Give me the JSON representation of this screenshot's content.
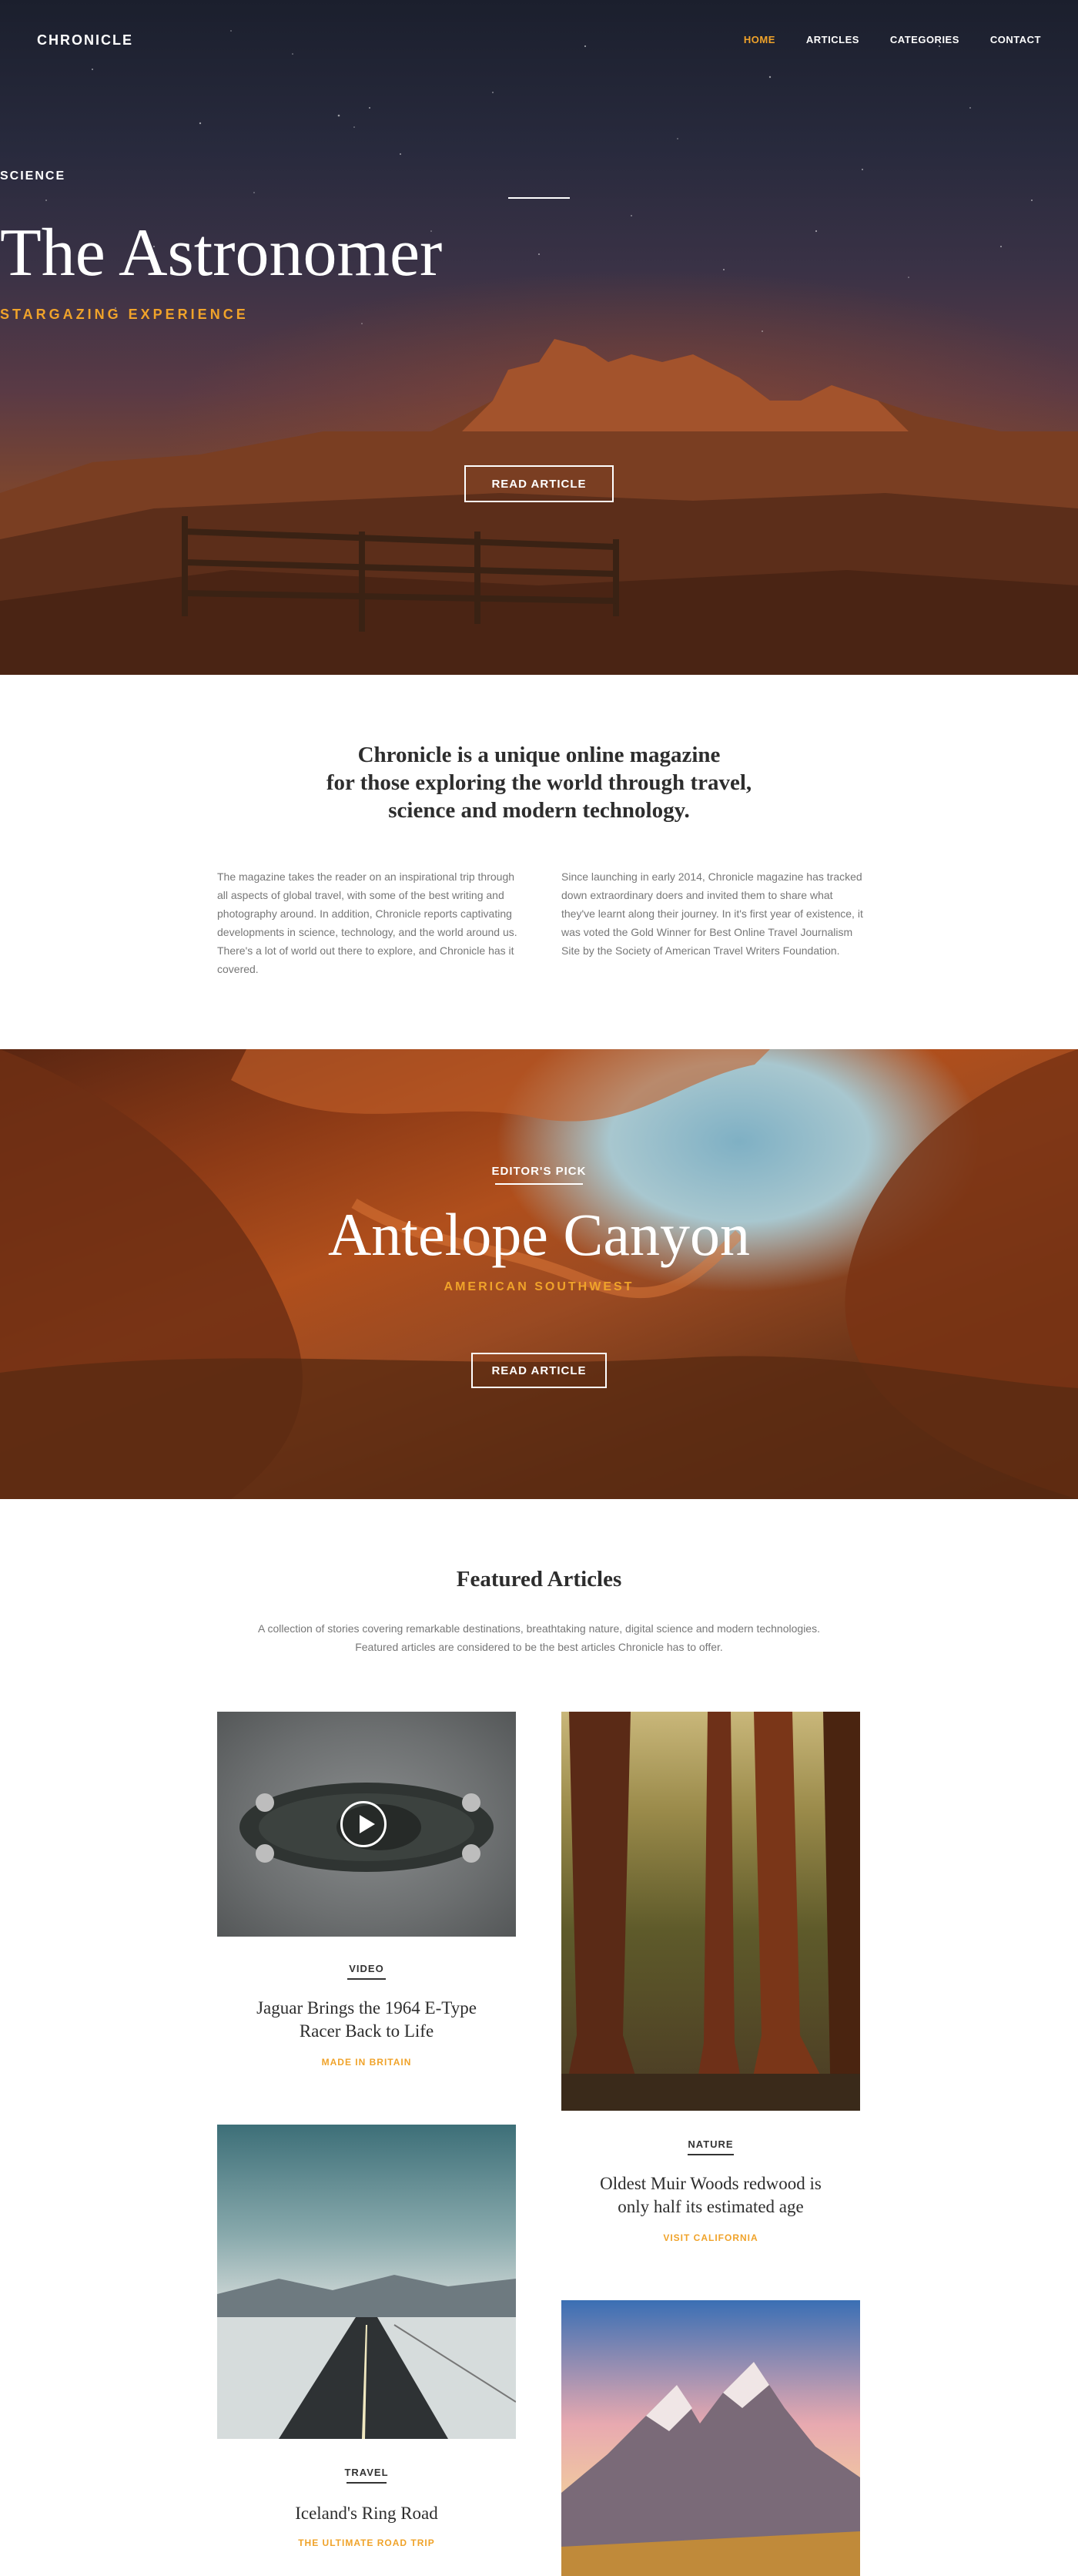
{
  "nav": {
    "logo": "CHRONICLE",
    "items": [
      {
        "label": "HOME",
        "active": true
      },
      {
        "label": "ARTICLES",
        "active": false
      },
      {
        "label": "CATEGORIES",
        "active": false
      },
      {
        "label": "CONTACT",
        "active": false
      }
    ]
  },
  "hero": {
    "tag": "SCIENCE",
    "title": "The Astronomer",
    "subtitle": "STARGAZING EXPERIENCE",
    "button": "READ ARTICLE"
  },
  "intro": {
    "heading_lines": [
      "Chronicle is a unique online magazine",
      "for those exploring the world through travel,",
      "science and modern technology."
    ],
    "col_left": "The magazine takes the reader on an inspirational trip through all aspects of global travel, with some of the best writing and photography around. In addition, Chronicle reports captivating developments in science, technology, and the world around us. There's a lot of world out there to explore, and Chronicle has it covered.",
    "col_right": "Since launching in early 2014, Chronicle magazine has tracked down extraordinary doers and invited them to share what they've learnt along their journey. In it's first year of existence, it was voted the Gold Winner for Best Online Travel Journalism Site by the Society of American Travel Writers Foundation."
  },
  "editors_pick": {
    "tag": "EDITOR'S PICK",
    "title": "Antelope Canyon",
    "subtitle": "AMERICAN SOUTHWEST",
    "button": "READ ARTICLE"
  },
  "featured": {
    "title": "Featured Articles",
    "description": "A collection of stories covering remarkable destinations, breathtaking nature, digital science and modern technologies. Featured articles are considered to be the best articles Chronicle has to offer.",
    "cards": [
      {
        "tag": "VIDEO",
        "title_lines": [
          "Jaguar Brings the 1964 E-Type",
          "Racer Back to Life"
        ],
        "subtitle": "MADE IN BRITAIN"
      },
      {
        "tag": "NATURE",
        "title_lines": [
          "Oldest Muir Woods redwood is",
          "only half its estimated age"
        ],
        "subtitle": "VISIT CALIFORNIA"
      },
      {
        "tag": "TRAVEL",
        "title_lines": [
          "Iceland's Ring Road"
        ],
        "subtitle": "THE ULTIMATE ROAD TRIP"
      }
    ]
  }
}
